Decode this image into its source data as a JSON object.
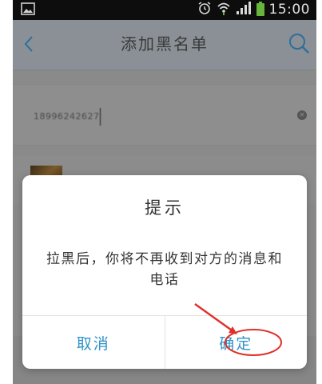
{
  "status_bar": {
    "time": "15:00",
    "icons": [
      "image-icon",
      "alarm-icon",
      "wifi-icon",
      "signal-icon",
      "battery-icon"
    ]
  },
  "nav": {
    "title": "添加黑名单",
    "back_icon": "chevron-left-icon",
    "search_icon": "search-icon"
  },
  "search": {
    "value": "18996242627",
    "clear_icon": "clear-icon"
  },
  "dialog": {
    "title": "提示",
    "message": "拉黑后，你将不再收到对方的消息和电话",
    "cancel_label": "取消",
    "confirm_label": "确定"
  },
  "colors": {
    "accent": "#2f93c8",
    "annotation": "#e0302a",
    "overlay": "#8a8a8a"
  }
}
